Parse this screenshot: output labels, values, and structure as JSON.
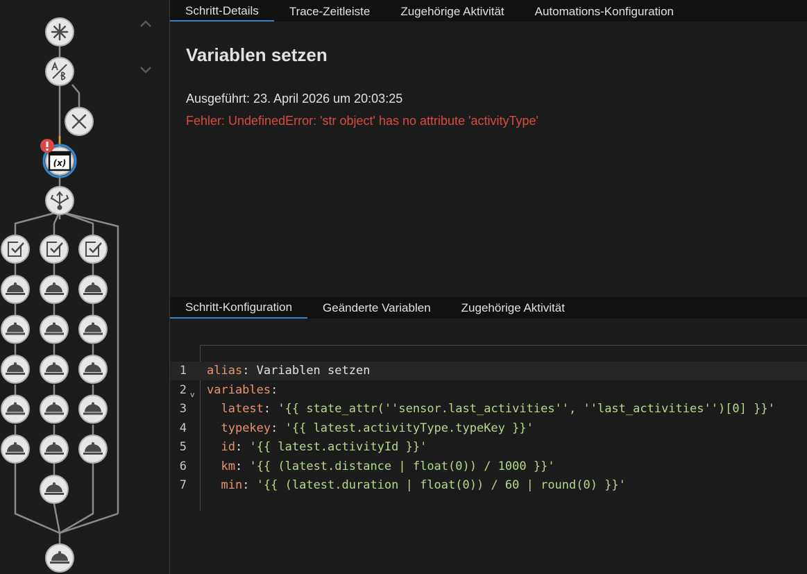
{
  "nav": {
    "prev": "chevron-up-icon",
    "next": "chevron-down-icon"
  },
  "graph_nodes": [
    {
      "id": "trigger",
      "icon": "asterisk-icon"
    },
    {
      "id": "choose",
      "icon": "ab-choose-icon"
    },
    {
      "id": "stop",
      "icon": "close-icon"
    },
    {
      "id": "variables",
      "icon": "variable-icon",
      "selected": true,
      "error": true
    },
    {
      "id": "parallel",
      "icon": "parallel-split-icon"
    },
    {
      "id": "condition",
      "icon": "check-box-icon"
    },
    {
      "id": "action",
      "icon": "service-bell-icon"
    }
  ],
  "colors": {
    "accent": "#2f87d7",
    "error": "#d64a43",
    "node_fill": "#e6e6e6",
    "node_stroke": "#b0b0b0"
  },
  "top_tabs": [
    {
      "label": "Schritt-Details",
      "active": true
    },
    {
      "label": "Trace-Zeitleiste",
      "active": false
    },
    {
      "label": "Zugehörige Aktivität",
      "active": false
    },
    {
      "label": "Automations-Konfiguration",
      "active": false
    }
  ],
  "details": {
    "title": "Variablen setzen",
    "executed": "Ausgeführt: 23. April 2026 um 20:03:25",
    "error": "Fehler: UndefinedError: 'str object' has no attribute 'activityType'"
  },
  "bottom_tabs": [
    {
      "label": "Schritt-Konfiguration",
      "active": true
    },
    {
      "label": "Geänderte Variablen",
      "active": false
    },
    {
      "label": "Zugehörige Aktivität",
      "active": false
    }
  ],
  "code_lines": [
    {
      "n": "1",
      "indent": "",
      "key": "alias",
      "sep": ": ",
      "value": "Variablen setzen",
      "value_type": "plain",
      "fold": ""
    },
    {
      "n": "2",
      "indent": "",
      "key": "variables",
      "sep": ":",
      "value": "",
      "value_type": "plain",
      "fold": "v"
    },
    {
      "n": "3",
      "indent": "  ",
      "key": "latest",
      "sep": ": ",
      "value": "'{{ state_attr(''sensor.last_activities'', ''last_activities'')[0] }}'",
      "value_type": "string",
      "fold": ""
    },
    {
      "n": "4",
      "indent": "  ",
      "key": "typekey",
      "sep": ": ",
      "value": "'{{ latest.activityType.typeKey }}'",
      "value_type": "string",
      "fold": ""
    },
    {
      "n": "5",
      "indent": "  ",
      "key": "id",
      "sep": ": ",
      "value": "'{{ latest.activityId }}'",
      "value_type": "string",
      "fold": ""
    },
    {
      "n": "6",
      "indent": "  ",
      "key": "km",
      "sep": ": ",
      "value": "'{{ (latest.distance | float(0)) / 1000 }}'",
      "value_type": "string",
      "fold": ""
    },
    {
      "n": "7",
      "indent": "  ",
      "key": "min",
      "sep": ": ",
      "value": "'{{ (latest.duration | float(0)) / 60 | round(0) }}'",
      "value_type": "string",
      "fold": ""
    }
  ]
}
